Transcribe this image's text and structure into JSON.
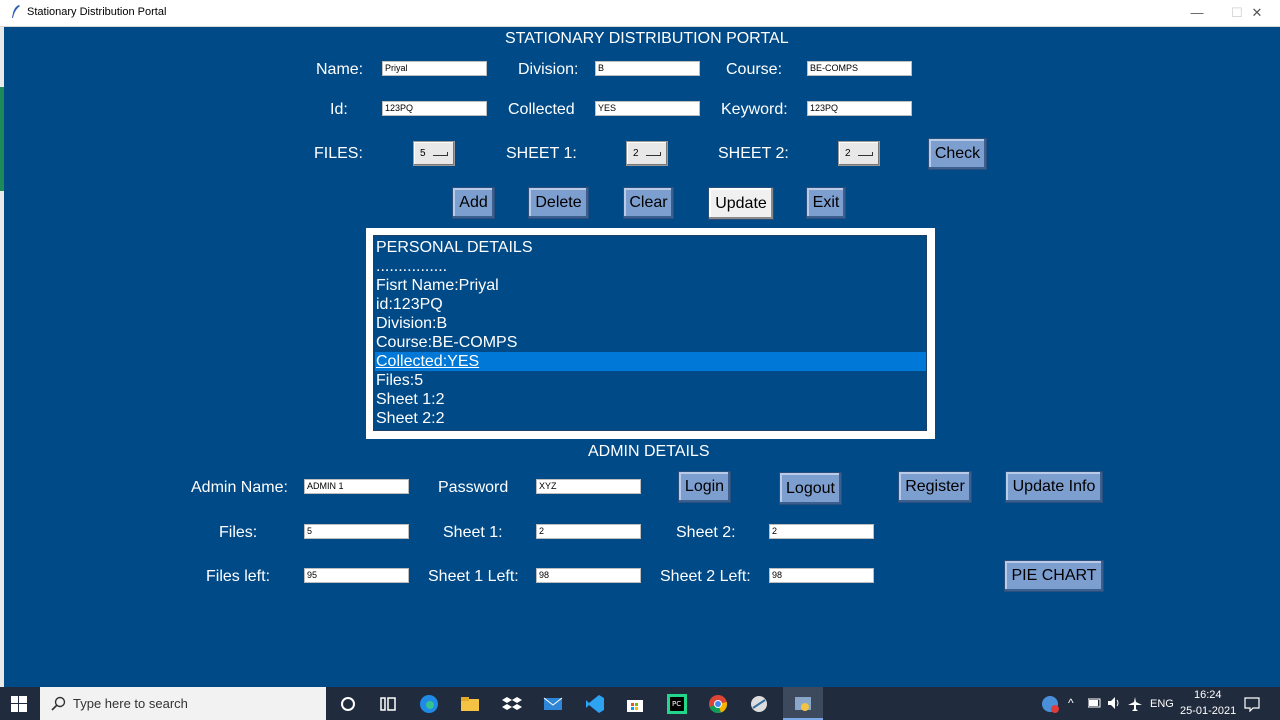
{
  "window": {
    "title": "Stationary Distribution Portal",
    "min": "—",
    "max": "☐",
    "close": "✕"
  },
  "header": {
    "title": "STATIONARY DISTRIBUTION PORTAL"
  },
  "form": {
    "name_label": "Name:",
    "name_value": "Priyal",
    "division_label": "Division:",
    "division_value": "B",
    "course_label": "Course:",
    "course_value": "BE-COMPS",
    "id_label": "Id:",
    "id_value": "123PQ",
    "collected_label": "Collected",
    "collected_value": "YES",
    "keyword_label": "Keyword:",
    "keyword_value": "123PQ",
    "files_label": "FILES:",
    "files_value": "5",
    "sheet1_label": "SHEET 1:",
    "sheet1_value": "2",
    "sheet2_label": "SHEET 2:",
    "sheet2_value": "2",
    "check_label": "Check"
  },
  "actions": {
    "add": "Add",
    "delete": "Delete",
    "clear": "Clear",
    "update": "Update",
    "exit": "Exit"
  },
  "details": {
    "items": [
      "PERSONAL DETAILS",
      "................",
      "Fisrt Name:Priyal",
      "id:123PQ",
      "Division:B",
      "Course:BE-COMPS",
      "Collected:YES",
      "Files:5",
      "Sheet 1:2",
      "Sheet 2:2"
    ],
    "selected_index": 6
  },
  "admin": {
    "title": "ADMIN DETAILS",
    "name_label": "Admin Name:",
    "name_value": "ADMIN 1",
    "password_label": "Password",
    "password_value": "XYZ",
    "login": "Login",
    "logout": "Logout",
    "register": "Register",
    "update_info": "Update Info",
    "files_label": "Files:",
    "files_value": "5",
    "sheet1_label": "Sheet 1:",
    "sheet1_value": "2",
    "sheet2_label": "Sheet 2:",
    "sheet2_value": "2",
    "files_left_label": "Files left:",
    "files_left_value": "95",
    "sheet1_left_label": "Sheet 1 Left:",
    "sheet1_left_value": "98",
    "sheet2_left_label": "Sheet 2 Left:",
    "sheet2_left_value": "98",
    "pie_chart": "PIE CHART"
  },
  "taskbar": {
    "search_placeholder": "Type here to search",
    "lang": "ENG",
    "time": "16:24",
    "date": "25-01-2021"
  },
  "colors": {
    "background": "#004a87",
    "button": "#7d9fd0",
    "selection": "#0078d7"
  }
}
